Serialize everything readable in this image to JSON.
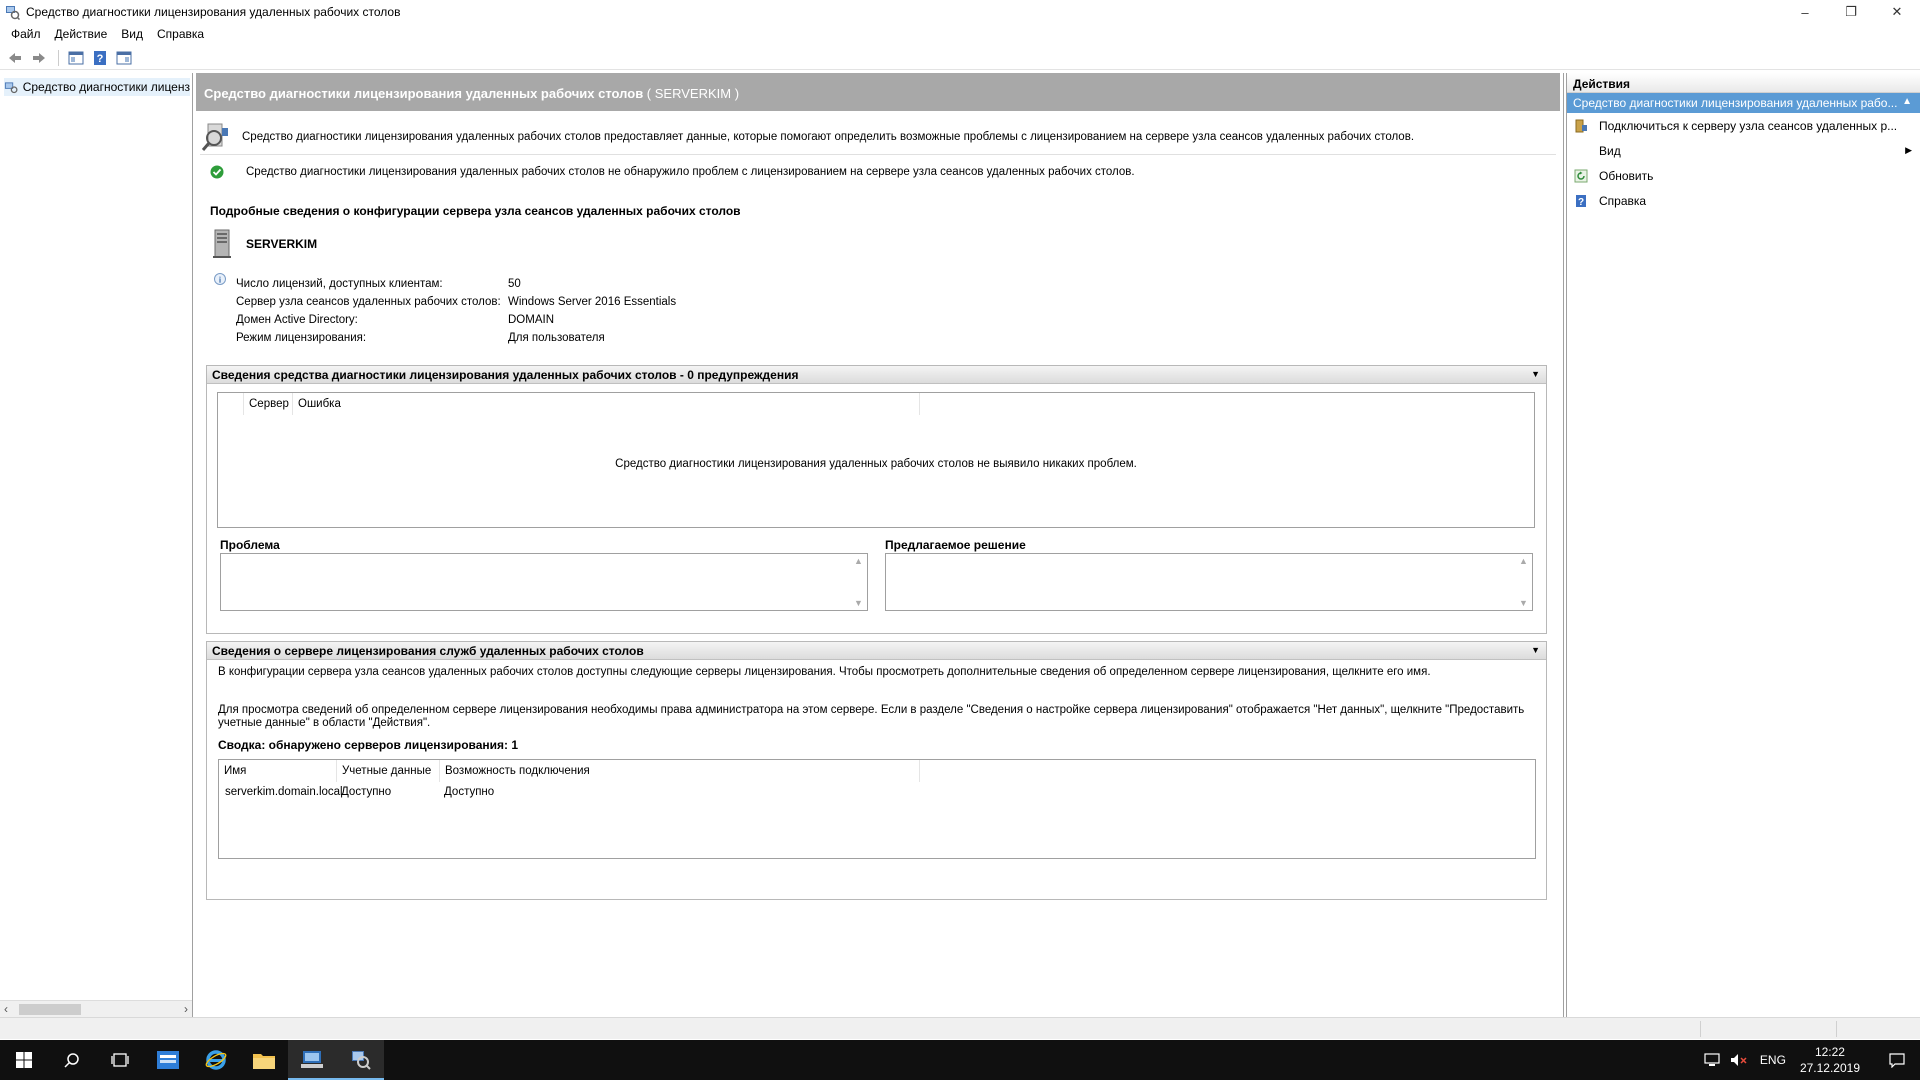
{
  "window": {
    "title": "Средство диагностики лицензирования удаленных рабочих столов",
    "icon": "rd-licensing-icon"
  },
  "menu": [
    "Файл",
    "Действие",
    "Вид",
    "Справка"
  ],
  "tree": {
    "item_label": "Средство диагностики лиценз"
  },
  "center": {
    "header_title": "Средство диагностики лицензирования удаленных рабочих столов",
    "header_server": " ( SERVERKIM )",
    "description": "Средство диагностики лицензирования удаленных рабочих столов предоставляет данные, которые помогают определить возможные проблемы с лицензированием на сервере узла сеансов удаленных рабочих столов.",
    "ok_message": "Средство диагностики лицензирования удаленных рабочих столов не обнаружило проблем с лицензированием на сервере узла сеансов удаленных рабочих столов.",
    "details_title": "Подробные сведения о конфигурации сервера узла сеансов удаленных рабочих столов",
    "server_name": "SERVERKIM",
    "config": [
      {
        "key": "Число лицензий, доступных клиентам:",
        "value": "50"
      },
      {
        "key": "Сервер узла сеансов удаленных рабочих столов:",
        "value": "Windows Server 2016 Essentials"
      },
      {
        "key": "Домен Active Directory:",
        "value": "DOMAIN"
      },
      {
        "key": "Режим лицензирования:",
        "value": "Для пользователя"
      }
    ],
    "warnings_section": {
      "title": "Сведения средства диагностики лицензирования удаленных рабочих столов - 0 предупреждения",
      "columns": [
        "Сервер",
        "Ошибка"
      ],
      "empty_message": "Средство диагностики лицензирования удаленных рабочих столов не выявило никаких проблем.",
      "problem_label": "Проблема",
      "solution_label": "Предлагаемое решение"
    },
    "license_section": {
      "title": "Сведения о сервере лицензирования служб удаленных рабочих столов",
      "text1": "В конфигурации сервера узла сеансов удаленных рабочих столов доступны следующие серверы лицензирования. Чтобы просмотреть дополнительные сведения об определенном сервере лицензирования, щелкните его имя.",
      "text2": "Для просмотра сведений об определенном сервере лицензирования необходимы права администратора на этом сервере. Если в разделе \"Сведения о настройке сервера лицензирования\" отображается \"Нет данных\", щелкните \"Предоставить учетные данные\" в области \"Действия\".",
      "summary": "Сводка: обнаружено серверов лицензирования: 1",
      "columns": [
        "Имя",
        "Учетные данные",
        "Возможность подключения"
      ],
      "rows": [
        [
          "serverkim.domain.local",
          "Доступно",
          "Доступно"
        ]
      ]
    }
  },
  "actions": {
    "header": "Действия",
    "selected": "Средство диагностики лицензирования удаленных рабо...",
    "items": [
      {
        "label": "Подключиться к серверу узла сеансов удаленных р...",
        "icon": "connect-server-icon"
      },
      {
        "label": "Вид",
        "icon": "none"
      },
      {
        "label": "Обновить",
        "icon": "refresh-icon"
      },
      {
        "label": "Справка",
        "icon": "help-icon"
      }
    ]
  },
  "taskbar": {
    "language": "ENG",
    "time": "12:22",
    "date": "27.12.2019"
  },
  "colors": {
    "header_gray": "#a8a8a8",
    "selection_blue": "#5b9bd5",
    "taskbar": "#101010"
  }
}
